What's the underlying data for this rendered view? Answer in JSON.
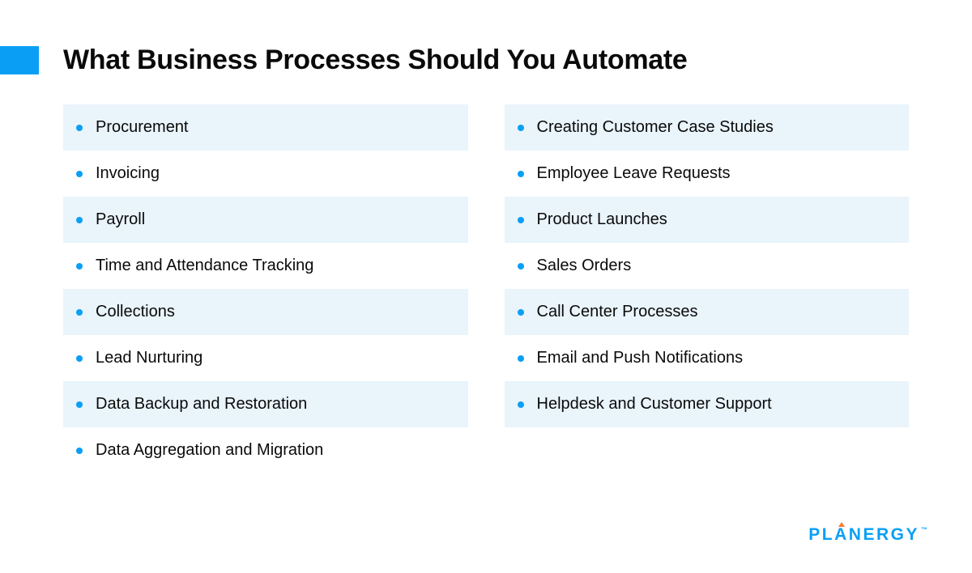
{
  "title": "What Business Processes Should You Automate",
  "columns": {
    "left": [
      "Procurement",
      "Invoicing",
      "Payroll",
      "Time and Attendance Tracking",
      "Collections",
      "Lead Nurturing",
      "Data Backup and Restoration",
      "Data Aggregation and Migration"
    ],
    "right": [
      "Creating Customer Case Studies",
      "Employee Leave Requests",
      "Product Launches",
      "Sales Orders",
      "Call Center Processes",
      "Email and Push Notifications",
      "Helpdesk and Customer Support"
    ]
  },
  "logo": {
    "text": "PLANERGY",
    "tm": "™"
  }
}
